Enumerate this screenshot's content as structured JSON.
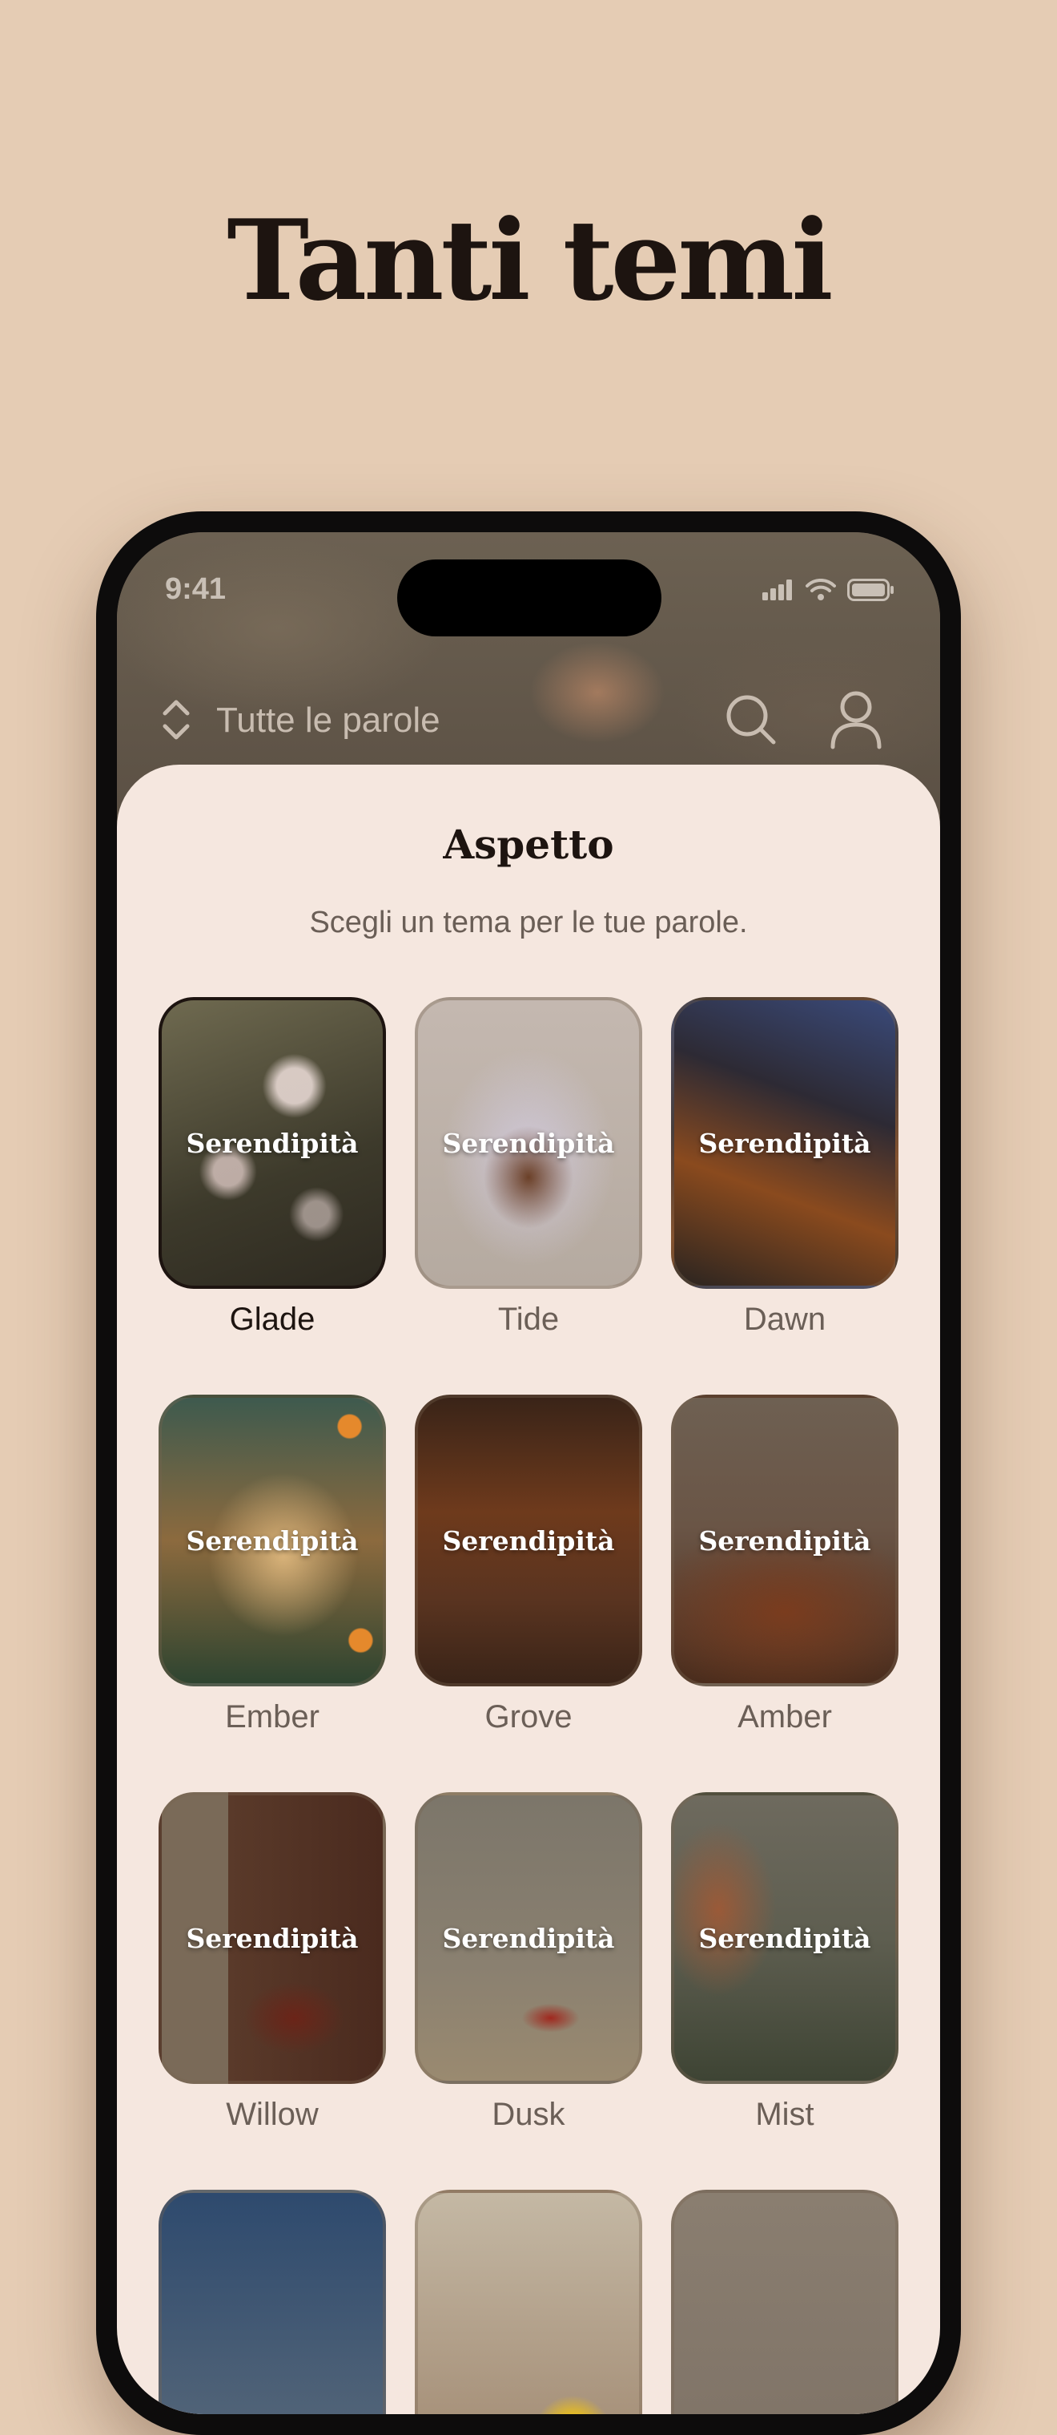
{
  "headline": "Tanti temi",
  "status_bar": {
    "time": "9:41"
  },
  "app_bar": {
    "title": "Tutte le parole"
  },
  "sheet": {
    "title": "Aspetto",
    "subtitle": "Scegli un tema per le tue parole."
  },
  "theme_preview_word": "Serendipità",
  "themes": [
    {
      "label": "Glade",
      "selected": true
    },
    {
      "label": "Tide",
      "selected": false
    },
    {
      "label": "Dawn",
      "selected": false
    },
    {
      "label": "Ember",
      "selected": false
    },
    {
      "label": "Grove",
      "selected": false
    },
    {
      "label": "Amber",
      "selected": false
    },
    {
      "label": "Willow",
      "selected": false
    },
    {
      "label": "Dusk",
      "selected": false
    },
    {
      "label": "Mist",
      "selected": false
    },
    {
      "label": "",
      "selected": false
    },
    {
      "label": "",
      "selected": false
    },
    {
      "label": "",
      "selected": false
    }
  ],
  "colors": {
    "page_background": "#e5ccb4",
    "sheet_background": "#f5e7df",
    "text_primary": "#1d1410",
    "text_secondary": "#6b5f57"
  }
}
